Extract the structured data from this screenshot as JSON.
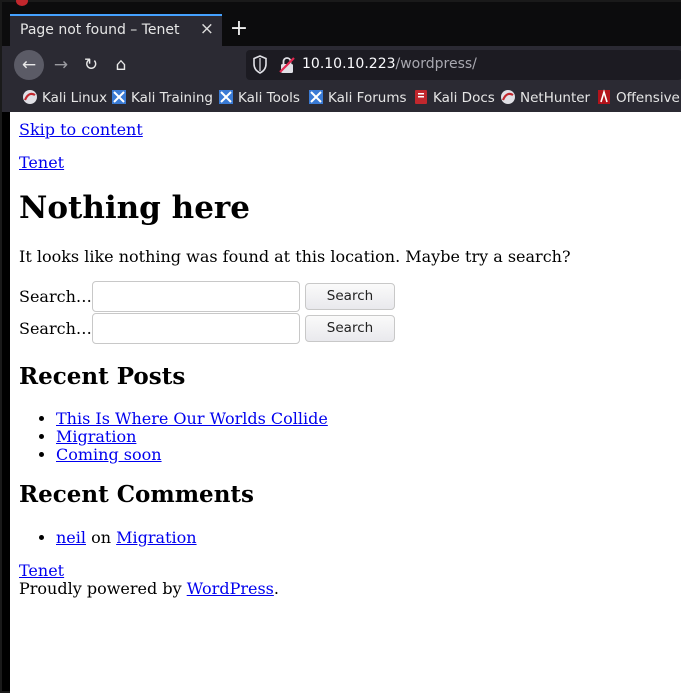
{
  "browser": {
    "tab": {
      "title": "Page not found – Tenet",
      "close_glyph": "×"
    },
    "new_tab_glyph": "+",
    "nav": {
      "back": "←",
      "forward": "→",
      "reload": "↻",
      "home": "⌂"
    },
    "url": {
      "host": "10.10.10.223",
      "path": "/wordpress/"
    },
    "bookmarks": [
      {
        "label": "Kali Linux"
      },
      {
        "label": "Kali Training"
      },
      {
        "label": "Kali Tools"
      },
      {
        "label": "Kali Forums"
      },
      {
        "label": "Kali Docs"
      },
      {
        "label": "NetHunter"
      },
      {
        "label": "Offensive S"
      }
    ],
    "colors": {
      "tab_accent": "#45a1ff",
      "chrome": "#2b2a33",
      "url_bg": "#1c1b22"
    }
  },
  "page": {
    "skip_link": "Skip to content",
    "site_title": "Tenet",
    "heading": "Nothing here",
    "message": "It looks like nothing was found at this location. Maybe try a search?",
    "search_forms": [
      {
        "label": "Search…",
        "value": "",
        "button": "Search"
      },
      {
        "label": "Search…",
        "value": "",
        "button": "Search"
      }
    ],
    "recent_posts": {
      "title": "Recent Posts",
      "items": [
        "This Is Where Our Worlds Collide",
        "Migration",
        "Coming soon"
      ]
    },
    "recent_comments": {
      "title": "Recent Comments",
      "items": [
        {
          "author": "neil",
          "on": "on",
          "post": "Migration"
        }
      ]
    },
    "footer": {
      "site_title": "Tenet",
      "powered_prefix": "Proudly powered by ",
      "powered_link": "WordPress",
      "powered_suffix": "."
    },
    "colors": {
      "link": "#0000ee",
      "text": "#000000",
      "background": "#ffffff"
    }
  }
}
